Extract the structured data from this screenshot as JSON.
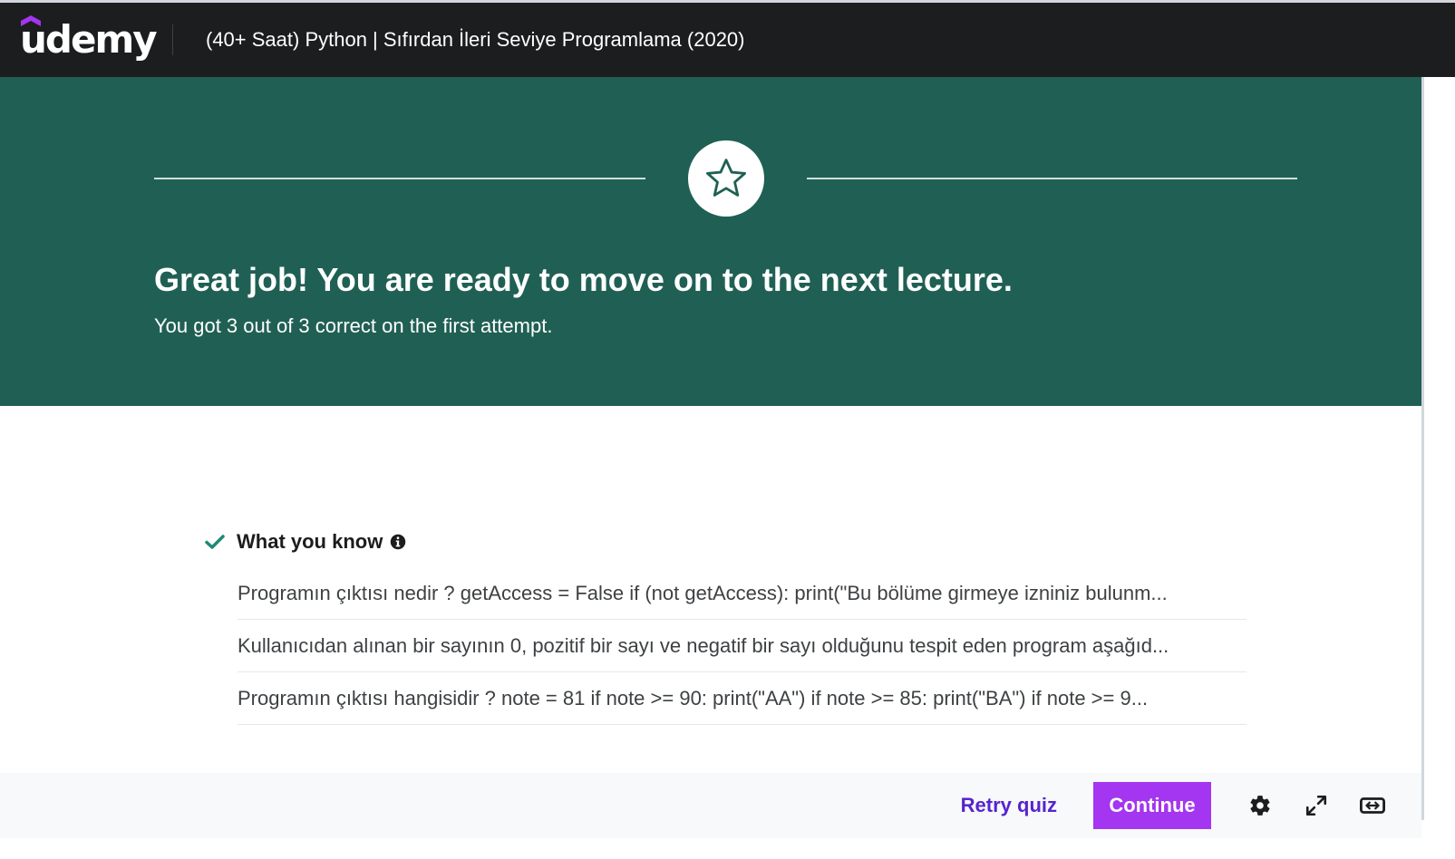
{
  "header": {
    "logo_text": "udemy",
    "course_title": "(40+ Saat) Python | Sıfırdan İleri Seviye Programlama (2020)"
  },
  "hero": {
    "icon": "star-icon",
    "heading": "Great job! You are ready to move on to the next lecture.",
    "subtext": "You got 3 out of 3 correct on the first attempt.",
    "background_color": "#206054"
  },
  "what_you_know": {
    "title": "What you know",
    "items": [
      "Programın çıktısı nedir ? getAccess = False if (not getAccess): print(\"Bu bölüme girmeye izniniz bulunm...",
      "Kullanıcıdan alınan bir sayının 0, pozitif bir sayı ve negatif bir sayı olduğunu tespit eden program aşağıd...",
      "Programın çıktısı hangisidir ? note = 81 if note >= 90: print(\"AA\") if note >= 85: print(\"BA\") if note >= 9..."
    ]
  },
  "footer": {
    "retry_label": "Retry quiz",
    "continue_label": "Continue",
    "continue_color": "#a435f0",
    "icons": [
      "gear-icon",
      "expand-icon",
      "widescreen-icon"
    ]
  }
}
